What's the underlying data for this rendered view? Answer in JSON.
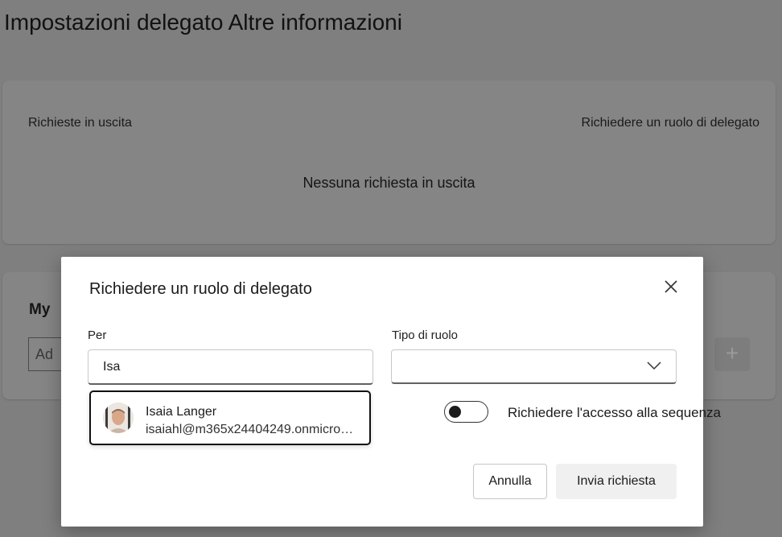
{
  "page": {
    "title": "Impostazioni delegato Altre informazioni"
  },
  "outgoing_card": {
    "label": "Richieste in uscita",
    "request_link": "Richiedere un ruolo di delegato",
    "empty_text": "Nessuna richiesta in uscita"
  },
  "mine_card": {
    "title": "My",
    "input_value": "Ad",
    "add_icon": "plus-icon"
  },
  "dialog": {
    "title": "Richiedere un ruolo di delegato",
    "close_icon": "close-icon",
    "per_label": "Per",
    "per_value": "Isa",
    "role_type_label": "Tipo di ruolo",
    "role_type_value": "",
    "suggestion": {
      "name": "Isaia Langer",
      "email": "isaiahl@m365x24404249.onmicro…"
    },
    "toggle": {
      "label": "Richiedere l'accesso alla sequenza",
      "state": "off"
    },
    "cancel_label": "Annulla",
    "send_label": "Invia richiesta"
  }
}
